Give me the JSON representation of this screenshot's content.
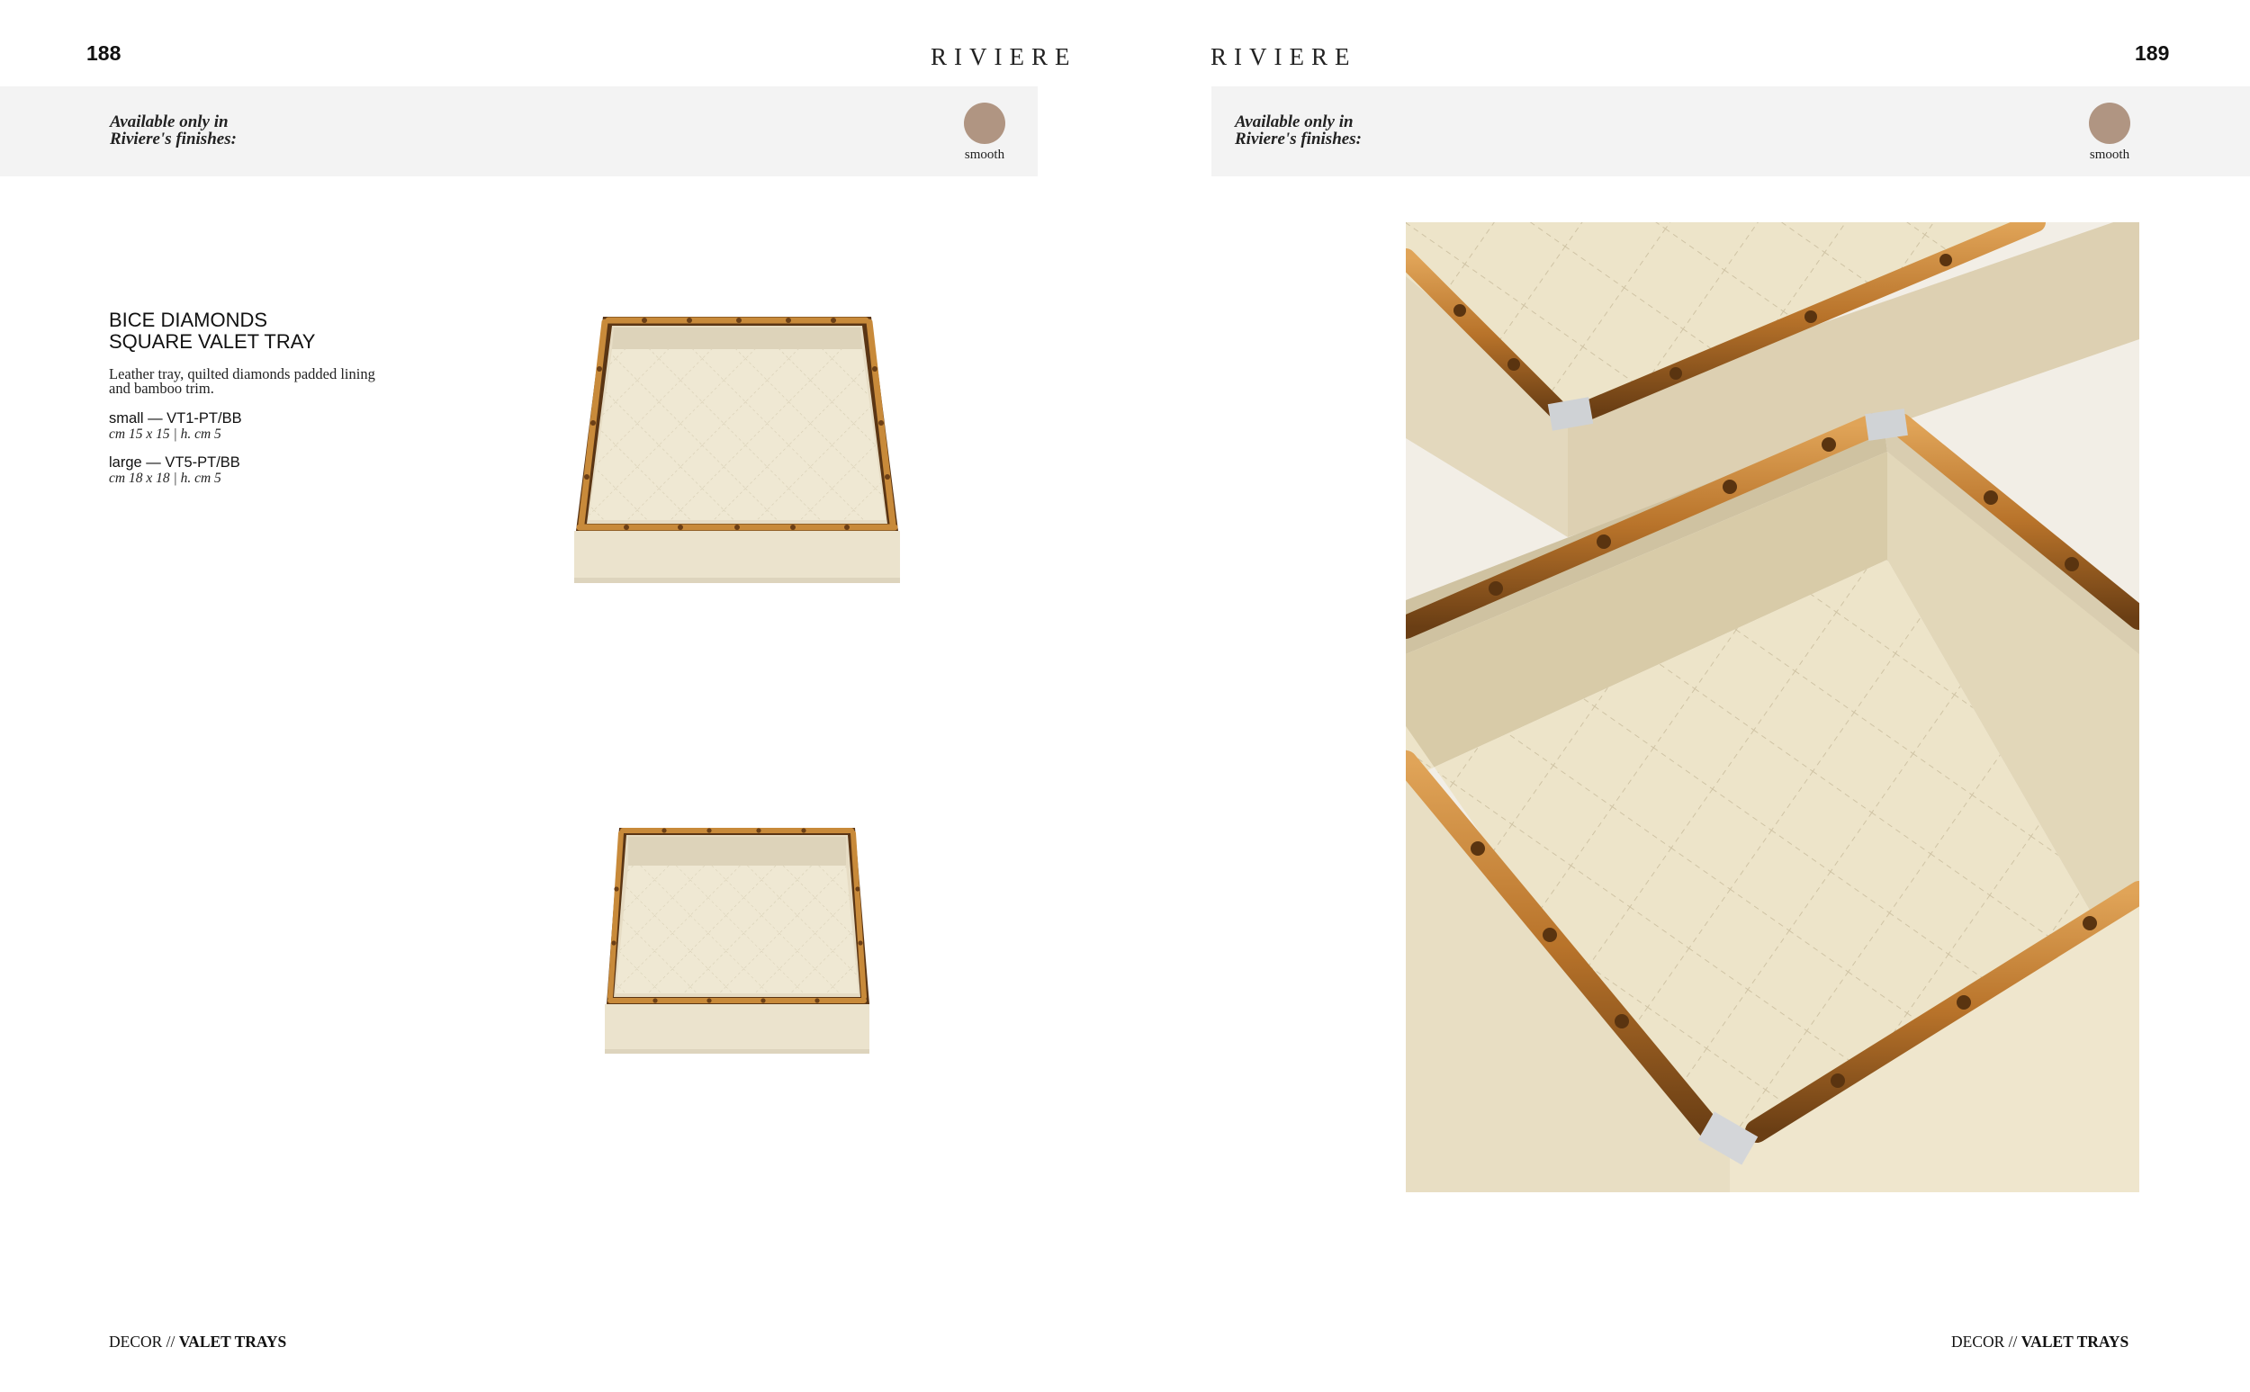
{
  "left_page": {
    "page_number": "188",
    "brand": "RIVIERE",
    "finishes": {
      "heading_line1": "Available only in",
      "heading_line2": "Riviere's finishes:",
      "swatch_label": "smooth",
      "swatch_color": "#b09582"
    },
    "product": {
      "title_line1": "BICE DIAMONDS",
      "title_line2": "SQUARE VALET TRAY",
      "description_line1": "Leather tray, quilted diamonds padded lining",
      "description_line2": "and bamboo trim.",
      "variants": [
        {
          "name": "small — VT1-PT/BB",
          "dims": "cm 15 x 15 | h. cm 5"
        },
        {
          "name": "large — VT5-PT/BB",
          "dims": "cm 18 x 18 | h. cm 5"
        }
      ]
    },
    "footer": {
      "section": "DECOR //",
      "category": "VALET TRAYS"
    }
  },
  "right_page": {
    "page_number": "189",
    "brand": "RIVIERE",
    "finishes": {
      "heading_line1": "Available only in",
      "heading_line2": "Riviere's finishes:",
      "swatch_label": "smooth",
      "swatch_color": "#b09582"
    },
    "footer": {
      "section": "DECOR //",
      "category": "VALET TRAYS"
    }
  },
  "colors": {
    "leather_cream": "#ece4cf",
    "bamboo": "#b9772a",
    "bamboo_dark": "#5a3514",
    "band_gray": "#f3f3f3"
  }
}
